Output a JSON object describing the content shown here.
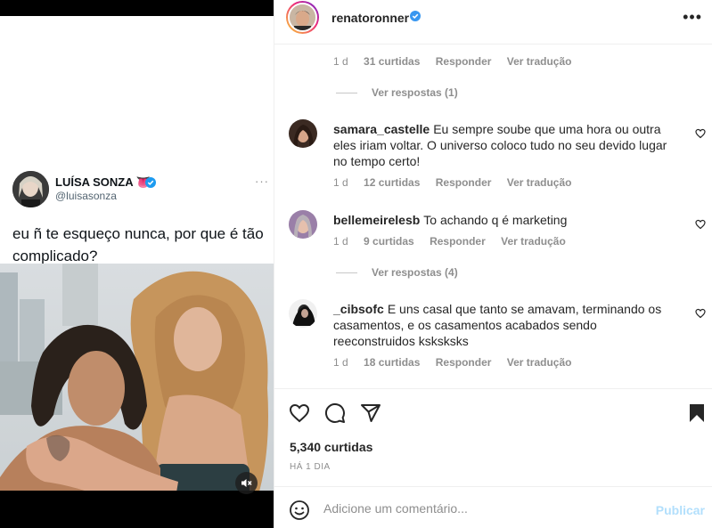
{
  "media": {
    "tweet": {
      "name": "LUÍSA SONZA 👅",
      "handle": "@luisasonza",
      "more": "···",
      "text": "eu ñ te esqueço nunca, por que é tão complicado?"
    },
    "mute_icon": "speaker-muted-icon"
  },
  "post": {
    "username": "renatoronner",
    "more": "•••",
    "verified_color": "#3897f0"
  },
  "comments": {
    "prev_meta": {
      "time": "1 d",
      "likes": "31 curtidas",
      "reply": "Responder",
      "translate": "Ver tradução"
    },
    "prev_replies": "Ver respostas (1)",
    "items": [
      {
        "user": "samara_castelle",
        "text": "Eu sempre soube que uma hora ou outra eles iriam voltar. O universo coloco tudo no seu devido lugar no tempo certo!",
        "time": "1 d",
        "likes": "12 curtidas",
        "reply": "Responder",
        "translate": "Ver tradução"
      },
      {
        "user": "bellemeirelesb",
        "text": "To achando q é marketing",
        "time": "1 d",
        "likes": "9 curtidas",
        "reply": "Responder",
        "translate": "Ver tradução",
        "replies": "Ver respostas (4)"
      },
      {
        "user": "_cibsofc",
        "text": "E uns casal que tanto se amavam, terminando os casamentos, e os casamentos acabados sendo reeconstruidos ksksksks",
        "time": "1 d",
        "likes": "18 curtidas",
        "reply": "Responder",
        "translate": "Ver tradução"
      }
    ]
  },
  "actions": {
    "likes": "5,340 curtidas",
    "date": "HÁ 1 DIA"
  },
  "add_comment": {
    "placeholder": "Adicione um comentário...",
    "publish": "Publicar"
  },
  "colors": {
    "text": "#262626",
    "muted": "#8e8e8e",
    "link_disabled": "#b2dffc"
  }
}
